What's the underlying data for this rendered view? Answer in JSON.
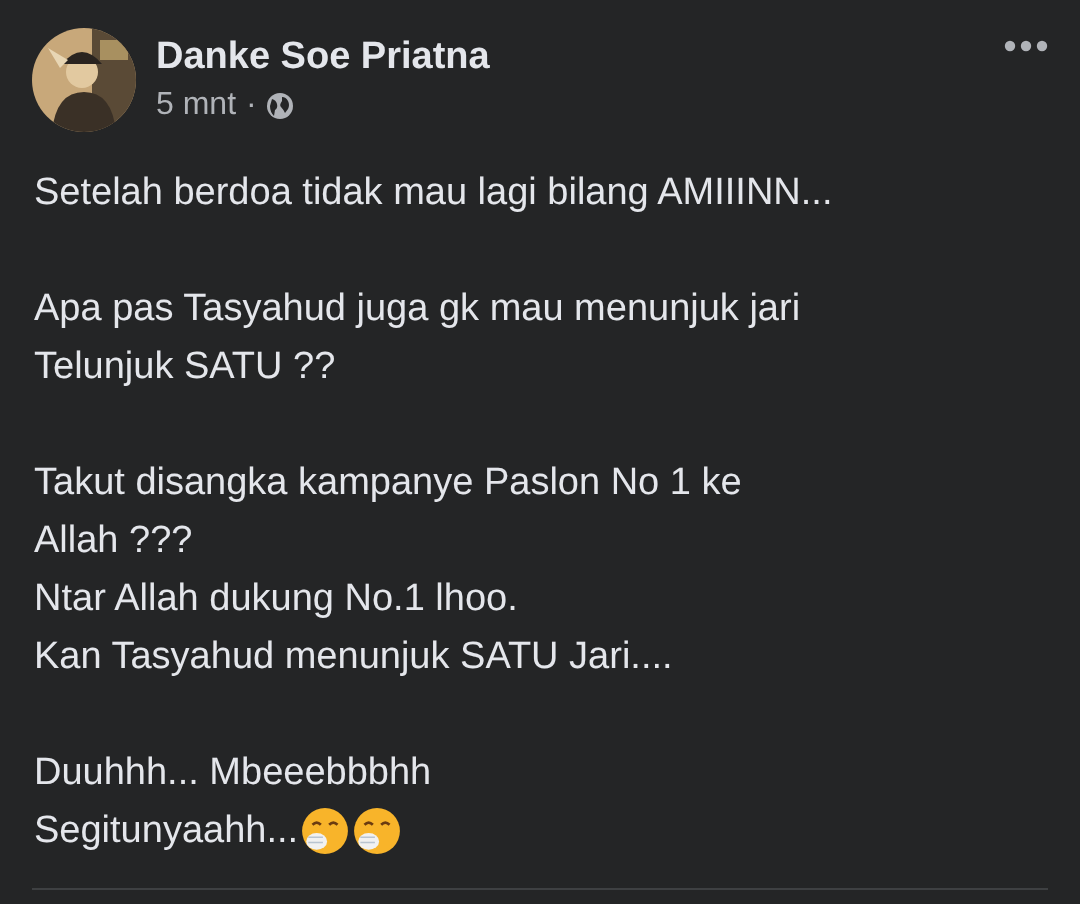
{
  "post": {
    "author": "Danke Soe Priatna",
    "time": "5 mnt",
    "separator": "·",
    "paragraphs": [
      {
        "lines": [
          "Setelah berdoa tidak mau lagi bilang AMIIINN..."
        ]
      },
      {
        "lines": [
          "Apa pas Tasyahud juga gk mau menunjuk jari",
          "Telunjuk SATU ??"
        ]
      },
      {
        "lines": [
          "Takut disangka kampanye Paslon No 1 ke",
          "Allah ???",
          "Ntar Allah dukung No.1 lhoo.",
          "Kan Tasyahud menunjuk SATU Jari...."
        ]
      },
      {
        "lines": [
          "Duuhhh... Mbeeebbbhh",
          "Segitunyaahh..."
        ],
        "emojis": [
          {
            "kind": "hand-over-mouth"
          },
          {
            "kind": "hand-over-mouth"
          }
        ]
      }
    ]
  }
}
